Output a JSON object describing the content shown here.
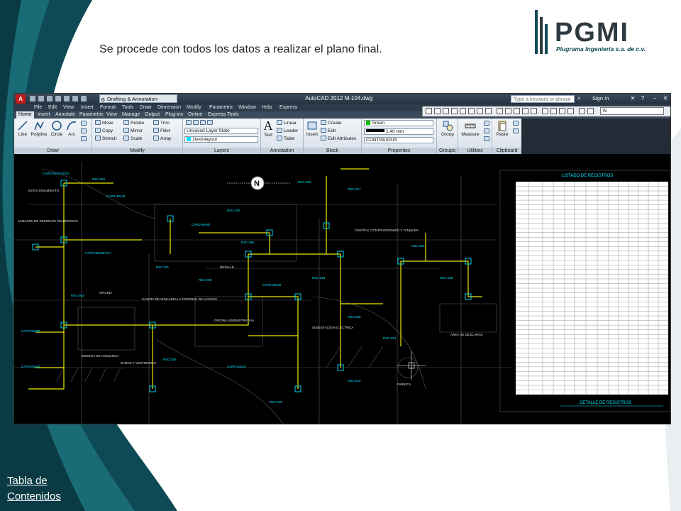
{
  "slide": {
    "caption": "Se procede con todos los datos a realizar el plano final.",
    "toc_line1": "Tabla de",
    "toc_line2": "Contenidos"
  },
  "logo": {
    "text": "PGMI",
    "tagline": "Plugrama Ingeniería s.a. de c.v."
  },
  "colors": {
    "teal_dark": "#0d4a55",
    "teal_mid": "#1b6f7a",
    "cad_cyan": "#00e5ff",
    "cad_yellow": "#e8e800",
    "ribbon_bg": "#e3e9ef"
  },
  "autocad": {
    "workspace": "Drafting & Annotation",
    "title": "AutoCAD 2012   M-104.dwg",
    "search_placeholder": "Type a keyword or phrase",
    "signin": "Sign In",
    "menus": [
      "File",
      "Edit",
      "View",
      "Insert",
      "Format",
      "Tools",
      "Draw",
      "Dimension",
      "Modify",
      "Parametric",
      "Window",
      "Help",
      "Express"
    ],
    "tabs": [
      "Home",
      "Insert",
      "Annotate",
      "Parametric",
      "View",
      "Manage",
      "Output",
      "Plug-ins",
      "Online",
      "Express Tools"
    ],
    "layer_dropdown": "N",
    "panels": {
      "draw": {
        "title": "Draw",
        "line": "Line",
        "polyline": "Polyline",
        "circle": "Circle",
        "arc": "Arc"
      },
      "modify": {
        "title": "Modify",
        "move": "Move",
        "rotate": "Rotate",
        "trim": "Trim",
        "copy": "Copy",
        "mirror": "Mirror",
        "fillet": "Fillet",
        "stretch": "Stretch",
        "scale": "Scale",
        "array": "Array"
      },
      "layers": {
        "title": "Layers",
        "state": "Unsaved Layer State",
        "current": "1textolayout"
      },
      "annotation": {
        "title": "Annotation",
        "text": "Text",
        "linear": "Linear",
        "leader": "Leader",
        "table": "Table"
      },
      "block": {
        "title": "Block",
        "insert": "Insert",
        "create": "Create",
        "edit": "Edit",
        "edit_attributes": "Edit Attributes"
      },
      "properties": {
        "title": "Properties",
        "color": "Green",
        "lineweight": "1.40 mm",
        "linetype": "CONTINUOUS"
      },
      "groups": {
        "title": "Groups",
        "group": "Group"
      },
      "utilities": {
        "title": "Utilities",
        "measure": "Measure"
      },
      "clipboard": {
        "title": "Clipboard",
        "paste": "Paste"
      }
    },
    "drawing": {
      "table_title": "LISTADO DE REGISTROS",
      "table_subtitle": "DETALLE DE REGISTROS",
      "north": "N",
      "labels": [
        "DETALLE",
        "ESTACIONAMIENTO",
        "OFICINA ADMINISTRATIVA",
        "CASETA DE VIGILANCIA Y CONTROL DE ACCESO",
        "BODEGA DE CONSUELA",
        "BAÑOS Y VESTIDORES",
        "CENTRAL CONTRAINCENDIO Y TANQUES",
        "AREA DE DESCARGA",
        "SUBESTACION ELECTRICA",
        "ALMACEN DE RESIDUOS PELIGROSOS",
        "OFICINA",
        "FABRICA"
      ]
    }
  }
}
